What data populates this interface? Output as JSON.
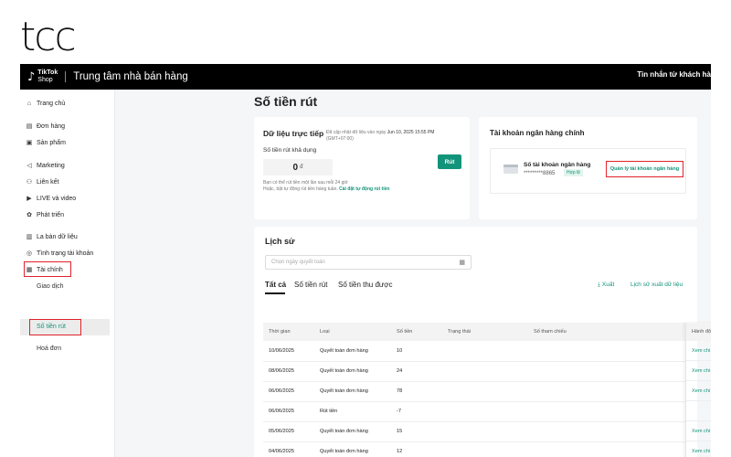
{
  "brand": "tcc",
  "topbar": {
    "logo_line1": "TikTok",
    "logo_line2": "Shop",
    "title": "Trung tâm nhà bán hàng",
    "right": "Tin nhắn từ khách hà"
  },
  "sidebar": {
    "items": [
      {
        "label": "Trang chủ",
        "icon": "home-icon",
        "glyph": "⌂"
      },
      {
        "label": "Đơn hàng",
        "icon": "orders-icon",
        "glyph": "▤"
      },
      {
        "label": "Sản phẩm",
        "icon": "products-icon",
        "glyph": "▣"
      },
      {
        "label": "Marketing",
        "icon": "megaphone-icon",
        "glyph": "◁"
      },
      {
        "label": "Liên kết",
        "icon": "affiliate-icon",
        "glyph": "⚇"
      },
      {
        "label": "LIVE và video",
        "icon": "live-icon",
        "glyph": "▶"
      },
      {
        "label": "Phát triển",
        "icon": "growth-icon",
        "glyph": "✿"
      },
      {
        "label": "La bàn dữ liệu",
        "icon": "compass-icon",
        "glyph": "▥"
      },
      {
        "label": "Tình trạng tài khoản",
        "icon": "account-health-icon",
        "glyph": "◎"
      },
      {
        "label": "Tài chính",
        "icon": "finance-icon",
        "glyph": "▦"
      }
    ],
    "sub_items": [
      "Giao dịch",
      "Số tiền rút",
      "Hoá đơn"
    ]
  },
  "page": {
    "title": "Số tiền rút"
  },
  "live_data": {
    "title": "Dữ liệu trực tiếp",
    "updated_prefix": "Đã cập nhật dữ liệu vào ngày",
    "updated_date": "Jun 10, 2025 15:55 PM",
    "timezone": "(GMT+07:00)",
    "balance_label": "Số tiền rút khả dụng",
    "balance_value": "0",
    "currency": "đ",
    "withdraw_button": "Rút",
    "note_line1": "Bạn có thể rút tiền một lần sau mỗi 24 giờ",
    "note_line2": "Hoặc, bật tự động rút tiền hàng tuần.",
    "auto_link": "Cài đặt tự động rút tiền"
  },
  "bank": {
    "title": "Tài khoản ngân hàng chính",
    "account_label": "Số tài khoản ngân hàng",
    "account_number": "*********8865",
    "status": "Hợp lệ",
    "manage_button": "Quản lý tài khoản ngân hàng"
  },
  "history": {
    "title": "Lịch sử",
    "date_placeholder": "Chọn ngày quyết toán",
    "tabs": [
      "Tất cả",
      "Số tiền rút",
      "Số tiền thu được"
    ],
    "export_label": "Xuất",
    "export_history": "Lịch sử xuất dữ liệu",
    "columns": [
      "Thời gian",
      "Loại",
      "Số tiền",
      "Trạng thái",
      "Số tham chiếu"
    ],
    "action_column": "Hành động",
    "rows": [
      {
        "time": "10/06/2025",
        "type": "Quyết toán đơn hàng",
        "amount": "10",
        "action": "Xem chi tiết"
      },
      {
        "time": "08/06/2025",
        "type": "Quyết toán đơn hàng",
        "amount": "24",
        "action": "Xem chi tiết"
      },
      {
        "time": "06/06/2025",
        "type": "Quyết toán đơn hàng",
        "amount": "78",
        "action": "Xem chi tiết"
      },
      {
        "time": "06/06/2025",
        "type": "Rút tiền",
        "amount": "-7",
        "action": ""
      },
      {
        "time": "05/06/2025",
        "type": "Quyết toán đơn hàng",
        "amount": "15",
        "action": "Xem chi tiết"
      },
      {
        "time": "04/06/2025",
        "type": "Quyết toán đơn hàng",
        "amount": "12",
        "action": "Xem chi tiết"
      }
    ]
  },
  "colors": {
    "accent": "#12947a",
    "highlight": "#e0222a",
    "topbar": "#000000"
  }
}
